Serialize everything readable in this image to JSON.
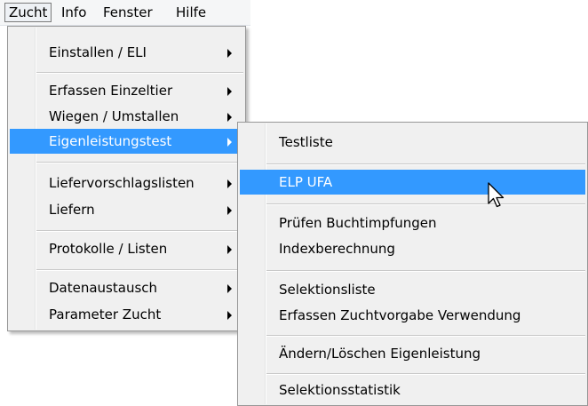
{
  "menubar": {
    "items": [
      {
        "label": "Zucht"
      },
      {
        "label": "Info"
      },
      {
        "label": "Fenster"
      },
      {
        "label": "Hilfe"
      }
    ]
  },
  "zucht_menu": {
    "items": [
      {
        "label": "Einstallen / ELI",
        "submenu": true
      },
      {
        "label": "Erfassen Einzeltier",
        "submenu": true
      },
      {
        "label": "Wiegen / Umstallen",
        "submenu": true
      },
      {
        "label": "Eigenleistungstest",
        "submenu": true,
        "highlighted": true
      },
      {
        "label": "Liefervorschlagslisten",
        "submenu": true
      },
      {
        "label": "Liefern",
        "submenu": true
      },
      {
        "label": "Protokolle / Listen",
        "submenu": true
      },
      {
        "label": "Datenaustausch",
        "submenu": true
      },
      {
        "label": "Parameter Zucht",
        "submenu": true
      }
    ]
  },
  "eigenleistungstest_submenu": {
    "items": [
      {
        "label": "Testliste"
      },
      {
        "label": "ELP UFA",
        "highlighted": true
      },
      {
        "label": "Prüfen Buchtimpfungen"
      },
      {
        "label": "Indexberechnung"
      },
      {
        "label": "Selektionsliste"
      },
      {
        "label": "Erfassen Zuchtvorgabe Verwendung"
      },
      {
        "label": "Ändern/Löschen Eigenleistung"
      },
      {
        "label": "Selektionsstatistik"
      }
    ]
  },
  "colors": {
    "highlight": "#3399ff",
    "menu_background": "#f0f0f0",
    "menubar_background": "#f5f6f7"
  },
  "icons": {
    "cursor": "arrow-cursor-icon",
    "submenu_arrow": "chevron-right-icon"
  }
}
